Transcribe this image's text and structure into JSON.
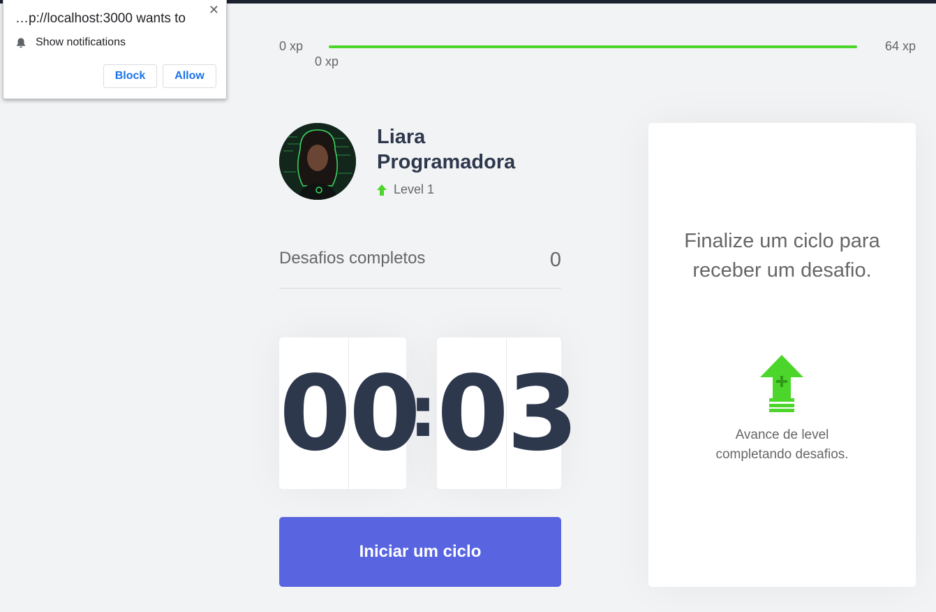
{
  "experience": {
    "min_label": "0 xp",
    "max_label": "64 xp",
    "current_label": "0 xp",
    "progress_fraction": 1.0,
    "bar_color": "#4cd62b"
  },
  "profile": {
    "name": "Liara Programadora",
    "level_label": "Level 1",
    "level_icon": "level-up-arrow-icon"
  },
  "completed_challenges": {
    "label": "Desafios completos",
    "count": "0"
  },
  "countdown": {
    "minute_left": "0",
    "minute_right": "0",
    "separator": ":",
    "second_left": "0",
    "second_right": "3"
  },
  "start_button": {
    "label": "Iniciar um ciclo",
    "color": "#5965e0"
  },
  "challenge_box": {
    "title": "Finalize um ciclo para receber um desafio.",
    "subtitle": "Avance de level completando desafios.",
    "icon": "level-up-icon"
  },
  "notification_prompt": {
    "origin_text": "…p://localhost:3000 wants to",
    "permission_label": "Show notifications",
    "permission_icon": "bell-icon",
    "block_label": "Block",
    "allow_label": "Allow",
    "close_icon": "close-icon"
  }
}
